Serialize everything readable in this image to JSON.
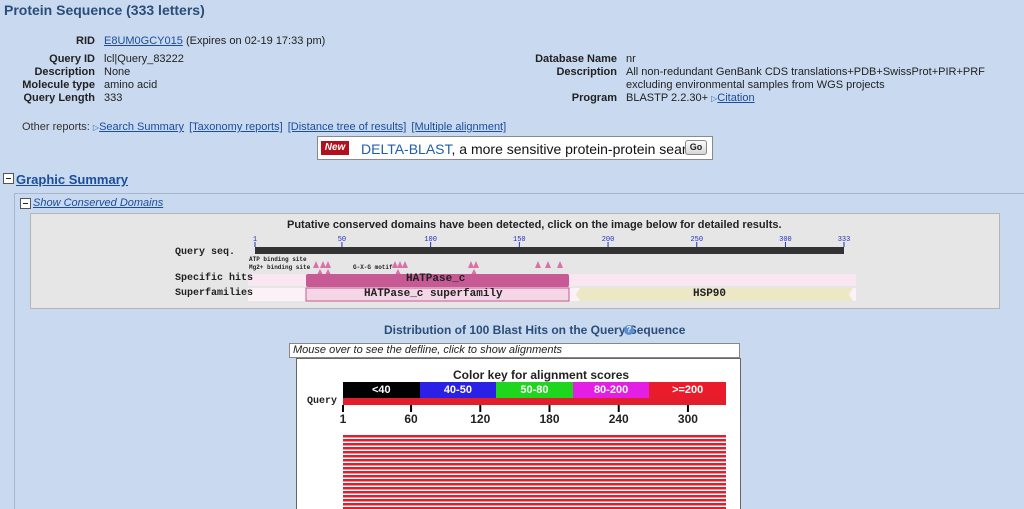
{
  "page": {
    "title": "Protein Sequence (333 letters)"
  },
  "rid": {
    "label": "RID",
    "id": "E8UM0GCY015",
    "expires": "(Expires on 02-19 17:33 pm)"
  },
  "left_info": [
    {
      "label": "Query ID",
      "value": "lcl|Query_83222"
    },
    {
      "label": "Description",
      "value": "None"
    },
    {
      "label": "Molecule type",
      "value": "amino acid"
    },
    {
      "label": "Query Length",
      "value": "333"
    }
  ],
  "right_info": {
    "db_label": "Database Name",
    "db_value": "nr",
    "desc_label": "Description",
    "desc_value": "All non-redundant GenBank CDS translations+PDB+SwissProt+PIR+PRF excluding environmental samples from WGS projects",
    "prog_label": "Program",
    "prog_value": "BLASTP 2.2.30+",
    "citation": "Citation"
  },
  "other_reports": {
    "label": "Other reports:",
    "links": [
      "Search Summary",
      "[Taxonomy reports]",
      "[Distance tree of results]",
      "[Multiple alignment]"
    ]
  },
  "delta": {
    "new_badge": "New",
    "name": "DELTA-BLAST",
    "text": ", a more sensitive protein-protein search",
    "go": "Go"
  },
  "graphic_summary": {
    "heading": "Graphic Summary",
    "show_domains": "Show Conserved Domains"
  },
  "domains": {
    "message": "Putative conserved domains have been detected, click on the image below for detailed results.",
    "query_label": "Query seq.",
    "ticks": [
      "1",
      "50",
      "100",
      "150",
      "200",
      "250",
      "300",
      "333"
    ],
    "site_labels": [
      "ATP binding site",
      "Mg2+ binding site",
      "G-X-G motif"
    ],
    "specific_label": "Specific hits",
    "superfamily_label": "Superfamilies",
    "specific_hit": "HATPase_c",
    "superfamilies": [
      "HATPase_c superfamily",
      "HSP90"
    ]
  },
  "distribution": {
    "title": "Distribution of 100 Blast Hits on the Query Sequence",
    "help": "?",
    "defline_placeholder": "Mouse over to see the defline, click to show alignments",
    "color_key_title": "Color key for alignment scores",
    "query_label": "Query",
    "score_bins": [
      {
        "label": "<40",
        "color": "#000000"
      },
      {
        "label": "40-50",
        "color": "#2b20e6"
      },
      {
        "label": "50-80",
        "color": "#1fd61f"
      },
      {
        "label": "80-200",
        "color": "#e41fe4"
      },
      {
        "label": ">=200",
        "color": "#ea1c2c"
      }
    ],
    "axis_ticks": [
      "1",
      "60",
      "120",
      "180",
      "240",
      "300"
    ],
    "hit_color": "#e31e2c"
  }
}
